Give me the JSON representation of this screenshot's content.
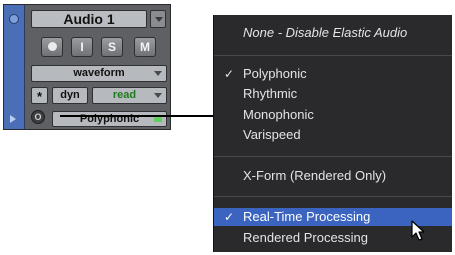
{
  "track": {
    "name": "Audio 1",
    "buttons": {
      "record": "",
      "input": "I",
      "solo": "S",
      "mute": "M"
    },
    "view": "waveform",
    "star": "*",
    "dyn": "dyn",
    "automation": "read",
    "elastic_plugin": "Polyphonic",
    "elastic_icon": "O"
  },
  "menu": {
    "items": [
      {
        "label": "None - Disable Elastic Audio",
        "italic": true
      },
      {
        "label": "Polyphonic",
        "checked": true
      },
      {
        "label": "Rhythmic"
      },
      {
        "label": "Monophonic"
      },
      {
        "label": "Varispeed"
      },
      {
        "label": "X-Form (Rendered Only)"
      },
      {
        "label": "Real-Time Processing",
        "checked": true,
        "selected": true
      },
      {
        "label": "Rendered Processing"
      }
    ],
    "check_mark": "✓"
  },
  "colors": {
    "menu_bg": "#2a2a2d",
    "highlight": "#3a64c0",
    "track_strip": "#4a6fb6",
    "automation_text": "#1e7a1e",
    "plugin_led": "#5fd05f"
  }
}
